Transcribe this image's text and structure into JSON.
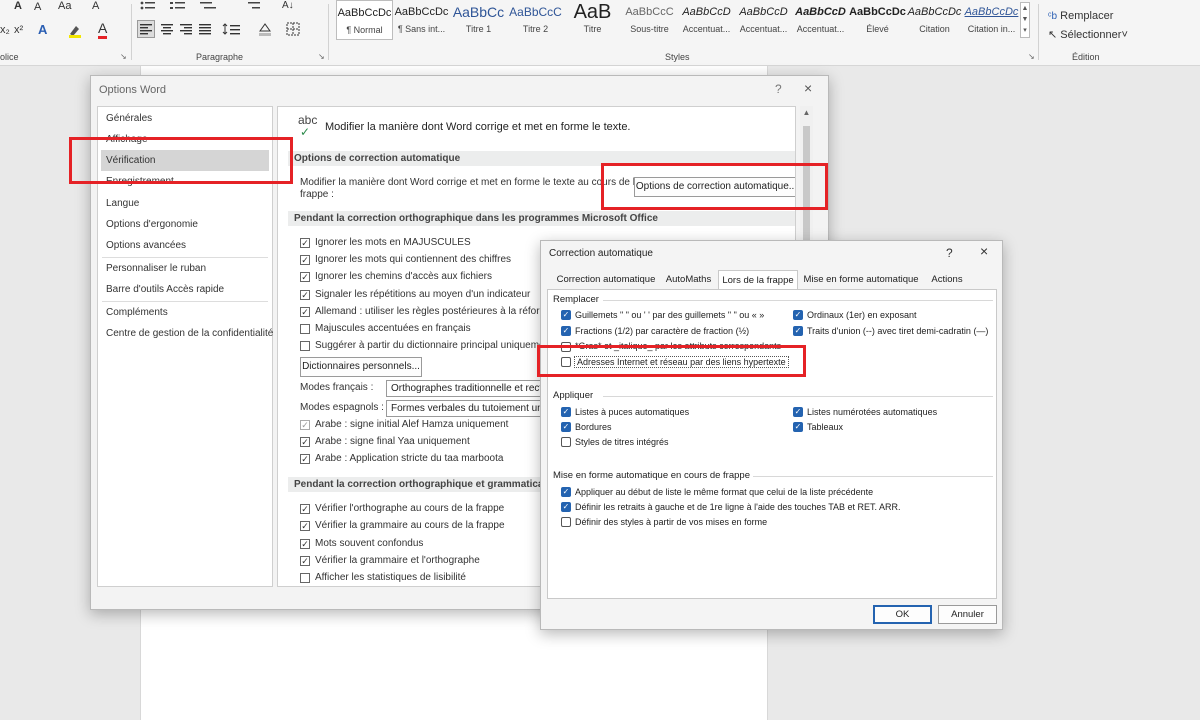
{
  "ribbon": {
    "row1_left": [
      "A",
      "A",
      "Aa",
      "A"
    ],
    "row2_left": [
      "x₂",
      "x²",
      "A",
      "A"
    ],
    "group_police": "olice",
    "group_paragraphe": "Paragraphe",
    "group_styles": "Styles",
    "group_edition": "Édition",
    "replace_label": "Remplacer",
    "select_label": "Sélectionner",
    "styles": [
      {
        "sample": "AaBbCcDc",
        "name": "¶ Normal"
      },
      {
        "sample": "AaBbCcDc",
        "name": "¶ Sans int..."
      },
      {
        "sample": "AaBbCc",
        "name": "Titre 1"
      },
      {
        "sample": "AaBbCcC",
        "name": "Titre 2"
      },
      {
        "sample": "AaB",
        "name": "Titre"
      },
      {
        "sample": "AaBbCcC",
        "name": "Sous-titre"
      },
      {
        "sample": "AaBbCcD",
        "name": "Accentuat..."
      },
      {
        "sample": "AaBbCcD",
        "name": "Accentuat..."
      },
      {
        "sample": "AaBbCcD",
        "name": "Accentuat..."
      },
      {
        "sample": "AaBbCcDc",
        "name": "Élevé"
      },
      {
        "sample": "AaBbCcDc",
        "name": "Citation"
      },
      {
        "sample": "AaBbCcDc",
        "name": "Citation in..."
      }
    ]
  },
  "word_options": {
    "title": "Options Word",
    "help": "?",
    "close": "×",
    "nav": [
      "Générales",
      "Affichage",
      "Vérification",
      "Enregistrement",
      "Langue",
      "Options d'ergonomie",
      "Options avancées",
      "Personnaliser le ruban",
      "Barre d'outils Accès rapide",
      "Compléments",
      "Centre de gestion de la confidentialité"
    ],
    "abc": "abc",
    "header_text": "Modifier la manière dont Word corrige et met en forme le texte.",
    "section_autocorrect": "Options de correction automatique",
    "autocorrect_desc_line1": "Modifier la manière dont Word corrige et met en forme le texte au cours de la",
    "autocorrect_desc_line2": "frappe :",
    "autocorrect_button": "Options de correction automatique...",
    "section_spelling": "Pendant la correction orthographique dans les programmes Microsoft Office",
    "spelling_options": [
      {
        "label": "Ignorer les mots en MAJUSCULES",
        "checked": true
      },
      {
        "label": "Ignorer les mots qui contiennent des chiffres",
        "checked": true
      },
      {
        "label": "Ignorer les chemins d'accès aux fichiers",
        "checked": true
      },
      {
        "label": "Signaler les répétitions au moyen d'un indicateur",
        "checked": true
      },
      {
        "label": "Allemand : utiliser les règles postérieures à la réforme de",
        "checked": true
      },
      {
        "label": "Majuscules accentuées en français",
        "checked": false
      },
      {
        "label": "Suggérer à partir du dictionnaire principal uniqueme",
        "checked": false
      }
    ],
    "dictionaries_button": "Dictionnaires personnels...",
    "modes_fr_label": "Modes français :",
    "modes_fr_value": "Orthographes traditionnelle et rectif",
    "modes_es_label": "Modes espagnols :",
    "modes_es_value": "Formes verbales du tutoiement uniq",
    "arabic_options": [
      {
        "label": "Arabe : signe initial Alef Hamza uniquement",
        "checked": true
      },
      {
        "label": "Arabe : signe final Yaa uniquement",
        "checked": true
      },
      {
        "label": "Arabe : Application stricte du taa marboota",
        "checked": true
      }
    ],
    "section_grammar": "Pendant la correction orthographique et grammaticale d",
    "grammar_options": [
      {
        "label": "Vérifier l'orthographe au cours de la frappe",
        "checked": true
      },
      {
        "label": "Vérifier la grammaire au cours de la frappe",
        "checked": true
      },
      {
        "label": "Mots souvent confondus",
        "checked": true
      },
      {
        "label": "Vérifier la grammaire et l'orthographe",
        "checked": true
      },
      {
        "label": "Afficher les statistiques de lisibilité",
        "checked": false
      }
    ]
  },
  "autocorrect": {
    "title": "Correction automatique",
    "help": "?",
    "close": "×",
    "tabs": [
      "Correction automatique",
      "AutoMaths",
      "Lors de la frappe",
      "Mise en forme automatique",
      "Actions"
    ],
    "group_replace": "Remplacer",
    "replace_left": [
      {
        "label": "Guillemets \" \" ou ' ' par des guillemets \" \" ou « »",
        "checked": true
      },
      {
        "label": "Fractions (1/2) par caractère de fraction (½)",
        "checked": true
      },
      {
        "label": "*Gras* et _italique_ par les attributs correspondants",
        "checked": false
      },
      {
        "label": "Adresses Internet et réseau par des liens hypertexte",
        "checked": false
      }
    ],
    "replace_right": [
      {
        "label": "Ordinaux (1er) en exposant",
        "checked": true
      },
      {
        "label": "Traits d'union (--) avec tiret demi-cadratin (—)",
        "checked": true
      }
    ],
    "group_apply": "Appliquer",
    "apply_left": [
      {
        "label": "Listes à puces automatiques",
        "checked": true
      },
      {
        "label": "Bordures",
        "checked": true
      },
      {
        "label": "Styles de titres intégrés",
        "checked": false
      }
    ],
    "apply_right": [
      {
        "label": "Listes numérotées automatiques",
        "checked": true
      },
      {
        "label": "Tableaux",
        "checked": true
      }
    ],
    "group_format": "Mise en forme automatique en cours de frappe",
    "format_options": [
      {
        "label": "Appliquer au début de liste le même format que celui de la liste précédente",
        "checked": true
      },
      {
        "label": "Définir les retraits à gauche et de 1re ligne à l'aide des touches TAB et RET. ARR.",
        "checked": true
      },
      {
        "label": "Définir des styles à partir de vos mises en forme",
        "checked": false
      }
    ],
    "ok": "OK",
    "cancel": "Annuler"
  }
}
